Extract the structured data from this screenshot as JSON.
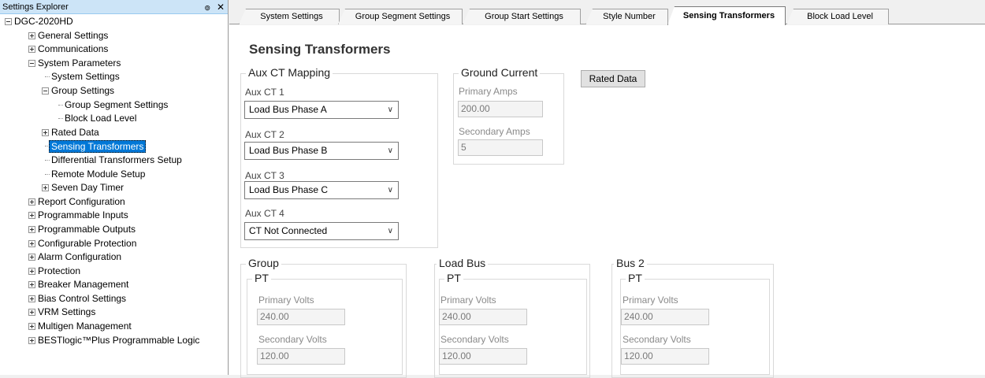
{
  "explorer": {
    "title": "Settings Explorer",
    "pin_glyph": "๏",
    "close_glyph": "✕",
    "tree": [
      {
        "label": "DGC-2020HD",
        "level": 0,
        "exp": "minus"
      },
      {
        "label": "General Settings",
        "level": 1,
        "exp": "plus"
      },
      {
        "label": "Communications",
        "level": 1,
        "exp": "plus"
      },
      {
        "label": "System Parameters",
        "level": 1,
        "exp": "minus"
      },
      {
        "label": "System Settings",
        "level": 2,
        "exp": "leaf"
      },
      {
        "label": "Group Settings",
        "level": 2,
        "exp": "minus"
      },
      {
        "label": "Group Segment Settings",
        "level": 3,
        "exp": "leaf"
      },
      {
        "label": "Block Load Level",
        "level": 3,
        "exp": "leaf"
      },
      {
        "label": "Rated Data",
        "level": 2,
        "exp": "plus"
      },
      {
        "label": "Sensing Transformers",
        "level": 2,
        "exp": "leaf",
        "selected": true
      },
      {
        "label": "Differential Transformers Setup",
        "level": 2,
        "exp": "leaf"
      },
      {
        "label": "Remote Module Setup",
        "level": 2,
        "exp": "leaf"
      },
      {
        "label": "Seven Day Timer",
        "level": 2,
        "exp": "plus"
      },
      {
        "label": "Report Configuration",
        "level": 1,
        "exp": "plus"
      },
      {
        "label": "Programmable Inputs",
        "level": 1,
        "exp": "plus"
      },
      {
        "label": "Programmable Outputs",
        "level": 1,
        "exp": "plus"
      },
      {
        "label": "Configurable Protection",
        "level": 1,
        "exp": "plus"
      },
      {
        "label": "Alarm Configuration",
        "level": 1,
        "exp": "plus"
      },
      {
        "label": "Protection",
        "level": 1,
        "exp": "plus"
      },
      {
        "label": "Breaker Management",
        "level": 1,
        "exp": "plus"
      },
      {
        "label": "Bias Control Settings",
        "level": 1,
        "exp": "plus"
      },
      {
        "label": "VRM Settings",
        "level": 1,
        "exp": "plus"
      },
      {
        "label": "Multigen Management",
        "level": 1,
        "exp": "plus"
      },
      {
        "label": "BESTlogic™Plus Programmable Logic",
        "level": 1,
        "exp": "plus"
      }
    ]
  },
  "tabs": [
    {
      "label": "System Settings",
      "active": false
    },
    {
      "label": "Group Segment Settings",
      "active": false
    },
    {
      "label": "Group Start Settings",
      "active": false
    },
    {
      "label": "Style Number",
      "active": false
    },
    {
      "label": "Sensing Transformers",
      "active": true
    },
    {
      "label": "Block Load Level",
      "active": false
    }
  ],
  "page": {
    "title": "Sensing Transformers",
    "aux_ct": {
      "title": "Aux CT Mapping",
      "ct1_label": "Aux CT 1",
      "ct1_value": "Load Bus Phase A",
      "ct2_label": "Aux CT 2",
      "ct2_value": "Load Bus Phase B",
      "ct3_label": "Aux CT 3",
      "ct3_value": "Load Bus Phase C",
      "ct4_label": "Aux CT 4",
      "ct4_value": "CT Not Connected"
    },
    "ground_current": {
      "title": "Ground Current",
      "primary_label": "Primary Amps",
      "primary_value": "200.00",
      "secondary_label": "Secondary Amps",
      "secondary_value": "5"
    },
    "rated_data_button": "Rated Data",
    "group": {
      "title": "Group",
      "pt_title": "PT",
      "primary_label": "Primary Volts",
      "primary_value": "240.00",
      "secondary_label": "Secondary Volts",
      "secondary_value": "120.00"
    },
    "load_bus": {
      "title": "Load Bus",
      "pt_title": "PT",
      "primary_label": "Primary Volts",
      "primary_value": "240.00",
      "secondary_label": "Secondary Volts",
      "secondary_value": "120.00"
    },
    "bus2": {
      "title": "Bus 2",
      "pt_title": "PT",
      "primary_label": "Primary Volts",
      "primary_value": "240.00",
      "secondary_label": "Secondary Volts",
      "secondary_value": "120.00"
    }
  },
  "icons": {
    "dropdown_chevron": "∨"
  }
}
